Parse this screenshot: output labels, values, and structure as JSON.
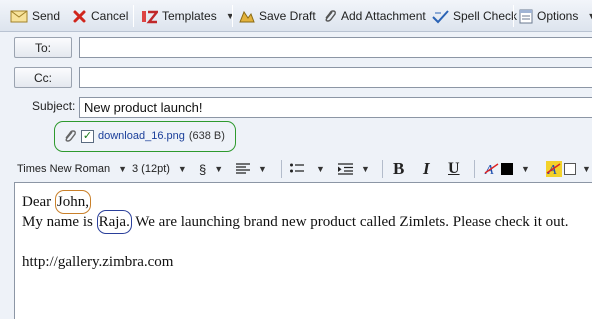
{
  "toolbar": {
    "send": "Send",
    "cancel": "Cancel",
    "templates": "Templates",
    "save_draft": "Save Draft",
    "add_attachment": "Add Attachment",
    "spell_check": "Spell Check",
    "options": "Options"
  },
  "compose": {
    "to_label": "To:",
    "to_value": "",
    "cc_label": "Cc:",
    "cc_value": "",
    "subject_label": "Subject:",
    "subject_value": "New product launch!"
  },
  "attachment": {
    "checked": true,
    "filename": "download_16.png",
    "size": "(638 B)"
  },
  "format": {
    "font_family": "Times New Roman",
    "font_size": "3 (12pt)",
    "text_color": "#000000",
    "highlight_color": "#ffffff"
  },
  "body": {
    "greeting_prefix": "Dear ",
    "greeting_name": "John,",
    "line2_prefix": "My name is ",
    "line2_name": "Raja.",
    "line2_suffix": " We are launching brand new product called Zimlets. Please check it out.",
    "link": "http://gallery.zimbra.com"
  },
  "colors": {
    "name_highlight_1": "#c9802a",
    "name_highlight_2": "#2a3f9a",
    "attachment_highlight": "#2e9a2e"
  }
}
